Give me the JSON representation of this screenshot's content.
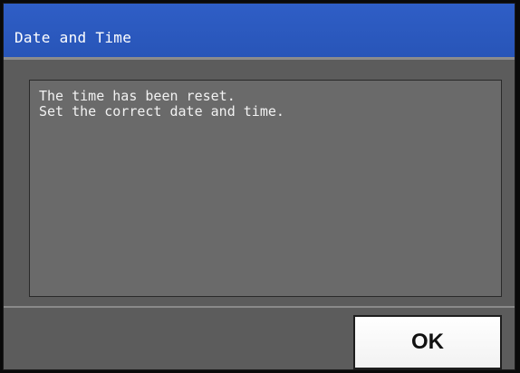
{
  "dialog": {
    "title": "Date and Time",
    "message": {
      "line1": "The time has been reset.",
      "line2": "Set the correct date and time."
    },
    "ok_label": "OK"
  },
  "colors": {
    "title_bar": "#2f5ec6",
    "panel": "#5c5c5c",
    "message_box": "#6a6a6a",
    "button": "#ffffff"
  }
}
